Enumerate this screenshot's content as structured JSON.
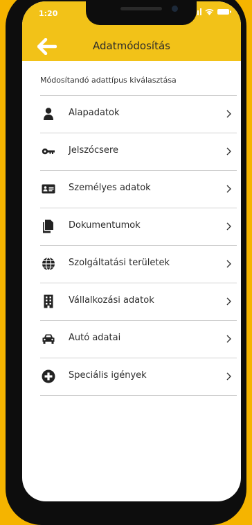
{
  "status": {
    "time": "1:20"
  },
  "header": {
    "title": "Adatmódosítás"
  },
  "subtitle": "Módosítandó adattípus kiválasztása",
  "items": [
    {
      "label": "Alapadatok",
      "icon": "person-icon"
    },
    {
      "label": "Jelszócsere",
      "icon": "key-icon"
    },
    {
      "label": "Személyes adatok",
      "icon": "id-card-icon"
    },
    {
      "label": "Dokumentumok",
      "icon": "documents-icon"
    },
    {
      "label": "Szolgáltatási területek",
      "icon": "globe-icon"
    },
    {
      "label": "Vállalkozási adatok",
      "icon": "building-icon"
    },
    {
      "label": "Autó adatai",
      "icon": "car-icon"
    },
    {
      "label": "Speciális igények",
      "icon": "plus-circle-icon"
    }
  ],
  "colors": {
    "accent": "#f2c218",
    "background": "#f5b400"
  }
}
